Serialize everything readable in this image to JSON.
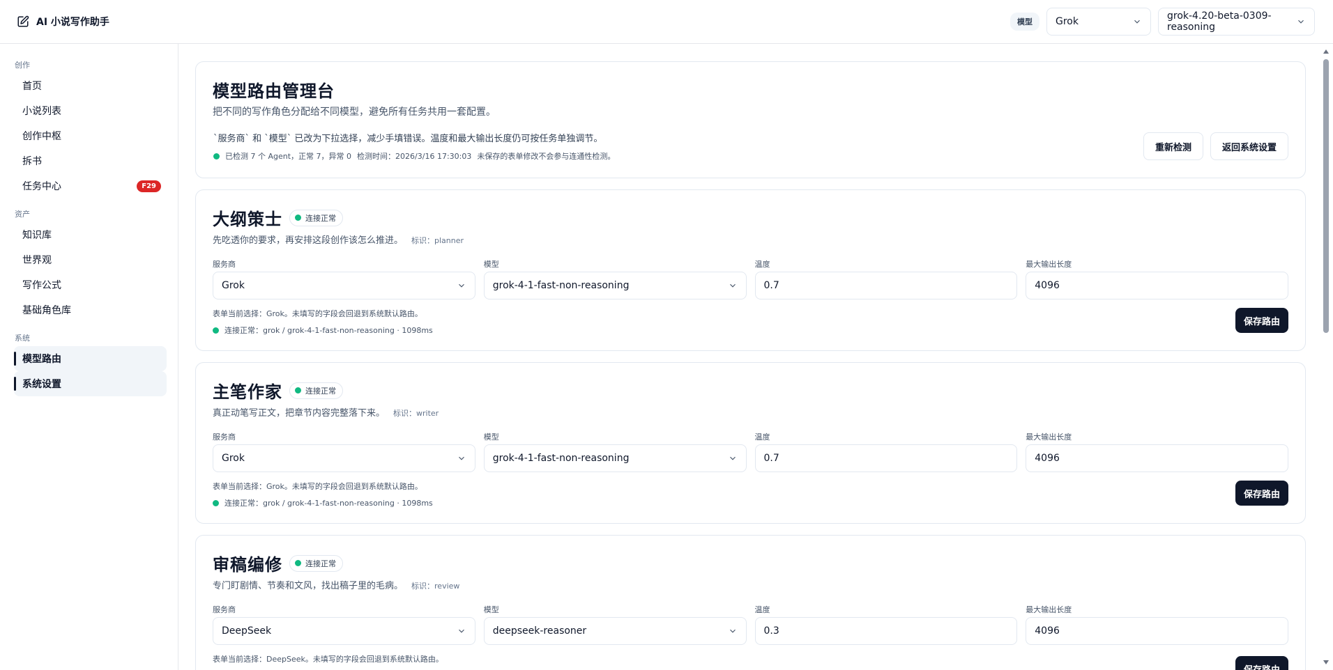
{
  "app": {
    "title": "AI 小说写作助手"
  },
  "topbar": {
    "model_tag": "模型",
    "provider_value": "Grok",
    "model_value": "grok-4.20-beta-0309-reasoning"
  },
  "sidebar": {
    "groups": [
      {
        "title": "创作",
        "items": [
          {
            "label": "首页"
          },
          {
            "label": "小说列表"
          },
          {
            "label": "创作中枢"
          },
          {
            "label": "拆书"
          },
          {
            "label": "任务中心",
            "badge": "F29"
          }
        ]
      },
      {
        "title": "资产",
        "items": [
          {
            "label": "知识库"
          },
          {
            "label": "世界观"
          },
          {
            "label": "写作公式"
          },
          {
            "label": "基础角色库"
          }
        ]
      },
      {
        "title": "系统",
        "items": [
          {
            "label": "模型路由"
          },
          {
            "label": "系统设置"
          }
        ]
      }
    ]
  },
  "header": {
    "title": "模型路由管理台",
    "subtitle": "把不同的写作角色分配给不同模型，避免所有任务共用一套配置。",
    "notice": "`服务商` 和 `模型` 已改为下拉选择，减少手填错误。温度和最大输出长度仍可按任务单独调节。",
    "check_summary": "已检测 7 个 Agent，正常 7，异常 0",
    "check_time": "检测时间：2026/3/16 17:30:03",
    "check_note": "未保存的表单修改不会参与连通性检测。",
    "recheck_label": "重新检测",
    "back_label": "返回系统设置"
  },
  "field_labels": {
    "provider": "服务商",
    "model": "模型",
    "temperature": "温度",
    "max_tokens": "最大输出长度"
  },
  "agents": [
    {
      "title": "大纲策士",
      "status": "连接正常",
      "desc": "先吃透你的要求，再安排这段创作该怎么推进。",
      "tag": "标识：planner",
      "provider": "Grok",
      "model": "grok-4-1-fast-non-reasoning",
      "temperature": "0.7",
      "max_tokens": "4096",
      "hint": "表单当前选择：Grok。未填写的字段会回退到系统默认路由。",
      "conn": "连接正常：grok / grok-4-1-fast-non-reasoning · 1098ms",
      "save_label": "保存路由"
    },
    {
      "title": "主笔作家",
      "status": "连接正常",
      "desc": "真正动笔写正文，把章节内容完整落下来。",
      "tag": "标识：writer",
      "provider": "Grok",
      "model": "grok-4-1-fast-non-reasoning",
      "temperature": "0.7",
      "max_tokens": "4096",
      "hint": "表单当前选择：Grok。未填写的字段会回退到系统默认路由。",
      "conn": "连接正常：grok / grok-4-1-fast-non-reasoning · 1098ms",
      "save_label": "保存路由"
    },
    {
      "title": "审稿编修",
      "status": "连接正常",
      "desc": "专门盯剧情、节奏和文风，找出稿子里的毛病。",
      "tag": "标识：review",
      "provider": "DeepSeek",
      "model": "deepseek-reasoner",
      "temperature": "0.3",
      "max_tokens": "4096",
      "hint": "表单当前选择：DeepSeek。未填写的字段会回退到系统默认路由。",
      "save_label": "保存路由"
    }
  ],
  "colors": {
    "primary": "#0f172a",
    "status_ok": "#10b981",
    "badge": "#dc2626",
    "border": "#e2e8f0"
  }
}
